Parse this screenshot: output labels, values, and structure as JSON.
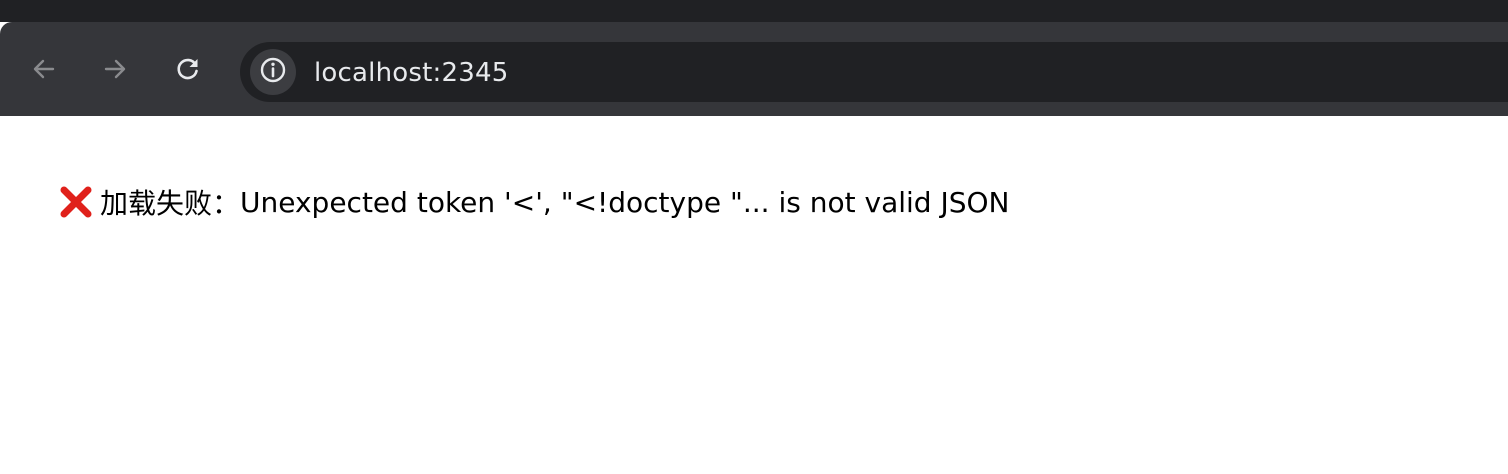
{
  "browser": {
    "url": "localhost:2345",
    "icons": {
      "back": "arrow-left-icon",
      "forward": "arrow-right-icon",
      "reload": "reload-icon",
      "site_info": "info-icon"
    },
    "colors": {
      "top_strip": "#202124",
      "toolbar": "#35363a",
      "omnibox": "#202124",
      "url_text": "#e8eaed",
      "icon_disabled": "#8a8b8e",
      "icon_active": "#e8eaed"
    }
  },
  "page": {
    "error": {
      "icon": "cross-mark-icon",
      "icon_color": "#e0211b",
      "prefix": "加载失败：",
      "message": "Unexpected token '<', \"<!doctype \"... is not valid JSON"
    }
  }
}
